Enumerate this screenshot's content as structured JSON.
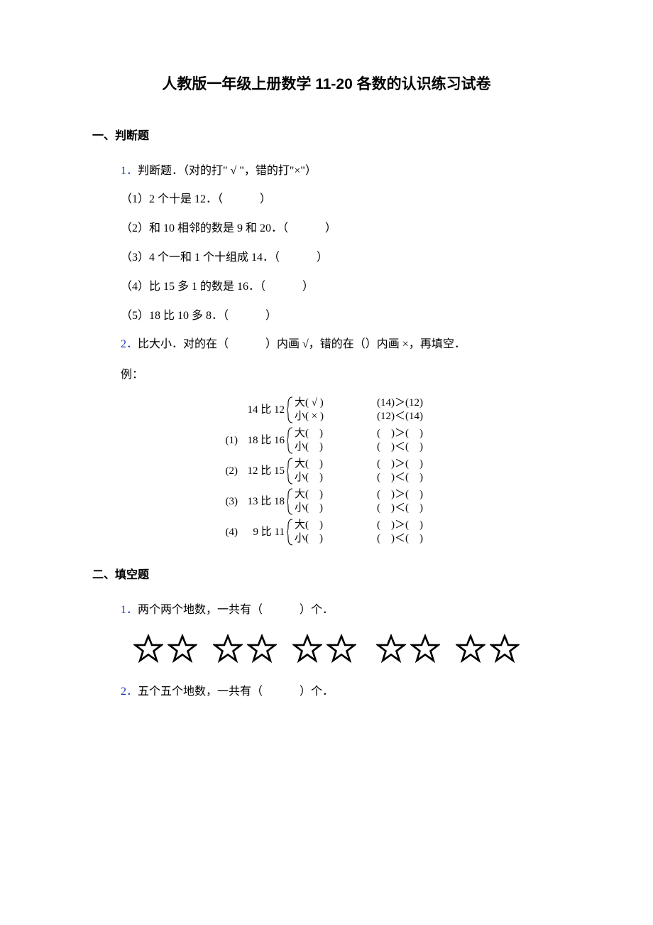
{
  "title": "人教版一年级上册数学 11-20 各数的认识练习试卷",
  "section1": {
    "heading": "一、判断题",
    "q1": {
      "num": "1．",
      "stem": "判断题．（对的打\" √ \"，错的打\"×\"）",
      "items": [
        "（1）2 个十是 12．（　　　 ）",
        "（2）和 10 相邻的数是 9 和 20．（　　　 ）",
        "（3）4 个一和 1 个十组成 14．（　　　 ）",
        "（4）比 15 多 1 的数是 16．（　　　 ）",
        "（5）18 比 10 多 8．（　　　 ）"
      ]
    },
    "q2": {
      "num": "2．",
      "stem": "比大小．对的在（　　　 ）内画 √，错的在（）内画 ×，再填空．",
      "example_label": "例：",
      "example": {
        "label": "14 比 12",
        "top_opt": "大( √ )",
        "bot_opt": "小( × )",
        "top_rhs": "(14)＞(12)",
        "bot_rhs": "(12)＜(14)"
      },
      "items": [
        {
          "prefix": "(1)",
          "label": "18 比 16",
          "top_opt": "大(　)",
          "bot_opt": "小(　)",
          "top_rhs": "(　)＞(　)",
          "bot_rhs": "(　)＜(　)"
        },
        {
          "prefix": "(2)",
          "label": "12 比 15",
          "top_opt": "大(　)",
          "bot_opt": "小(　)",
          "top_rhs": "(　)＞(　)",
          "bot_rhs": "(　)＜(　)"
        },
        {
          "prefix": "(3)",
          "label": "13 比 18",
          "top_opt": "大(　)",
          "bot_opt": "小(　)",
          "top_rhs": "(　)＞(　)",
          "bot_rhs": "(　)＜(　)"
        },
        {
          "prefix": "(4)",
          "label": "9 比 11",
          "top_opt": "大(　)",
          "bot_opt": "小(　)",
          "top_rhs": "(　)＞(　)",
          "bot_rhs": "(　)＜(　)"
        }
      ]
    }
  },
  "section2": {
    "heading": "二、填空题",
    "q1": {
      "num": "1．",
      "stem": "两个两个地数，一共有（　　　 ）个．"
    },
    "q2": {
      "num": "2．",
      "stem": "五个五个地数，一共有（　　　 ）个．"
    },
    "star_count": 10
  }
}
